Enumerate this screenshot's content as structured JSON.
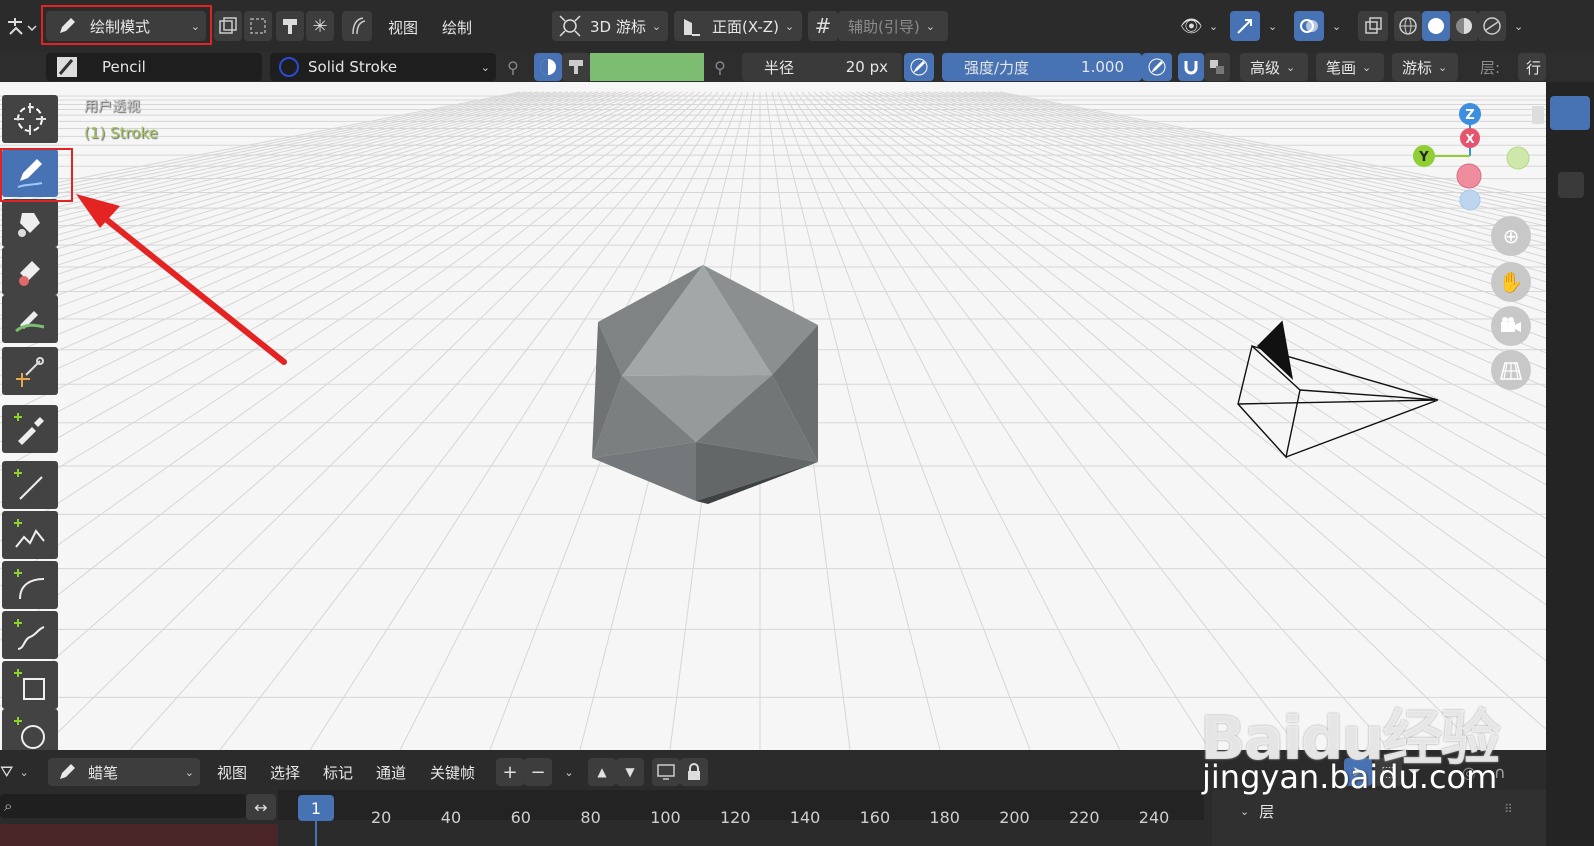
{
  "header": {
    "mode_label": "绘制模式",
    "menu_view": "视图",
    "menu_draw": "绘制",
    "transform_pivot": "3D 游标",
    "orientation": "正面(X-Z)",
    "guides_label": "辅助(引导)"
  },
  "tool_header": {
    "brush_name": "Pencil",
    "material_name": "Solid Stroke",
    "radius_label": "半径",
    "radius_value": "20 px",
    "strength_label": "强度/力度",
    "strength_value": "1.000",
    "advanced": "高级",
    "stroke": "笔画",
    "cursor": "游标",
    "layer_label": "层:",
    "layer_value": "行",
    "color_accent": "#7dbd72"
  },
  "viewport": {
    "view_name": "用户透视",
    "object_name": "(1) Stroke",
    "gizmo": {
      "z": "Z",
      "x": "X",
      "y": "Y"
    }
  },
  "toolbar": {
    "tools": [
      "cursor-icon",
      "draw-icon",
      "fill-icon",
      "erase-icon",
      "tint-icon",
      "cutter-icon",
      "eyedropper-icon",
      "line-icon",
      "polyline-icon",
      "arc-icon",
      "curve-icon",
      "box-icon",
      "circle-icon"
    ],
    "active_index": 1
  },
  "timeline": {
    "editor_name": "蜡笔",
    "menus": [
      "视图",
      "选择",
      "标记",
      "通道",
      "关键帧"
    ],
    "current_frame": "1",
    "frames": [
      "20",
      "40",
      "60",
      "80",
      "100",
      "120",
      "140",
      "160",
      "180",
      "200",
      "220",
      "240"
    ],
    "layers_label": "层"
  },
  "watermark": {
    "text": "jingyan.baidu.com"
  }
}
